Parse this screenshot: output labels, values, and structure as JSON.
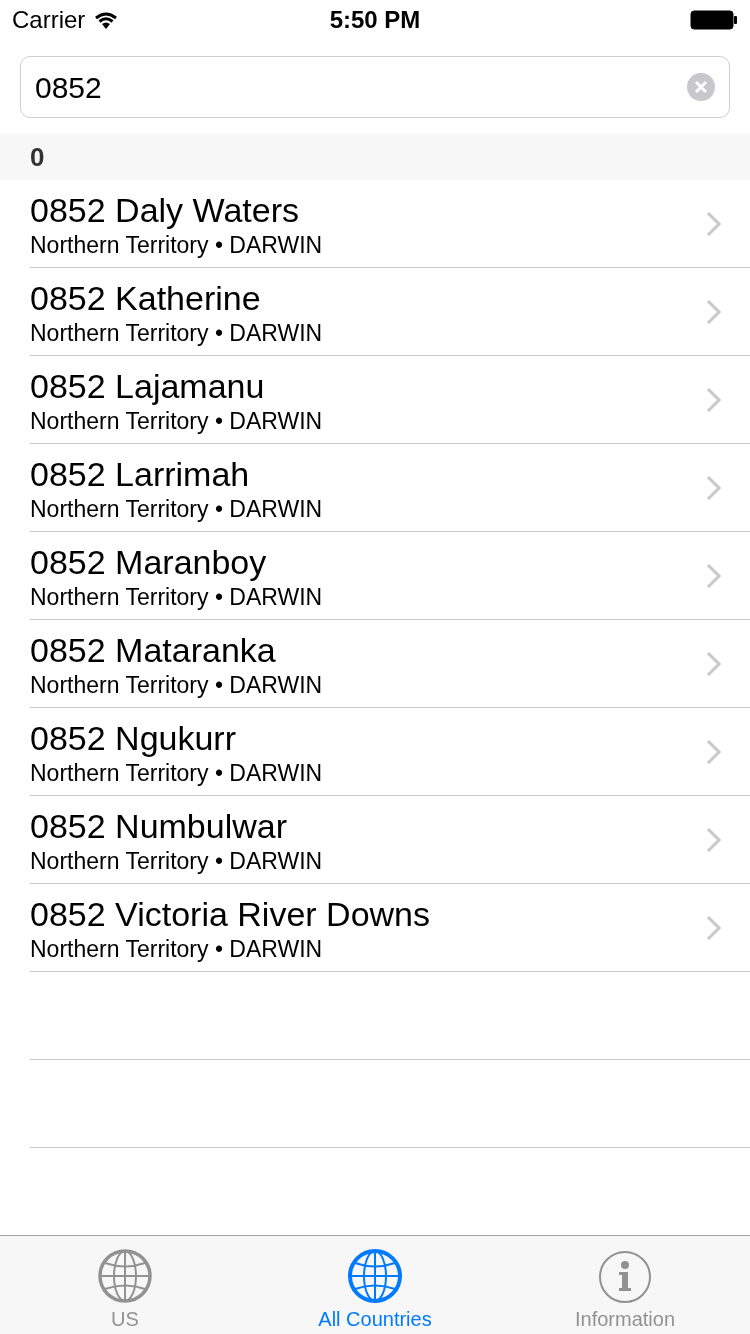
{
  "status_bar": {
    "carrier": "Carrier",
    "time": "5:50 PM"
  },
  "search": {
    "value": "0852"
  },
  "section": {
    "header": "0"
  },
  "rows": [
    {
      "title": "0852 Daly Waters",
      "subtitle": "Northern Territory • DARWIN"
    },
    {
      "title": "0852 Katherine",
      "subtitle": "Northern Territory • DARWIN"
    },
    {
      "title": "0852 Lajamanu",
      "subtitle": "Northern Territory • DARWIN"
    },
    {
      "title": "0852 Larrimah",
      "subtitle": "Northern Territory • DARWIN"
    },
    {
      "title": "0852 Maranboy",
      "subtitle": "Northern Territory • DARWIN"
    },
    {
      "title": "0852 Mataranka",
      "subtitle": "Northern Territory • DARWIN"
    },
    {
      "title": "0852 Ngukurr",
      "subtitle": "Northern Territory • DARWIN"
    },
    {
      "title": "0852 Numbulwar",
      "subtitle": "Northern Territory • DARWIN"
    },
    {
      "title": "0852 Victoria River Downs",
      "subtitle": "Northern Territory • DARWIN"
    }
  ],
  "tab_bar": [
    {
      "label": "US",
      "kind": "globe",
      "selected": false
    },
    {
      "label": "All Countries",
      "kind": "globe",
      "selected": true
    },
    {
      "label": "Information",
      "kind": "info",
      "selected": false
    }
  ]
}
